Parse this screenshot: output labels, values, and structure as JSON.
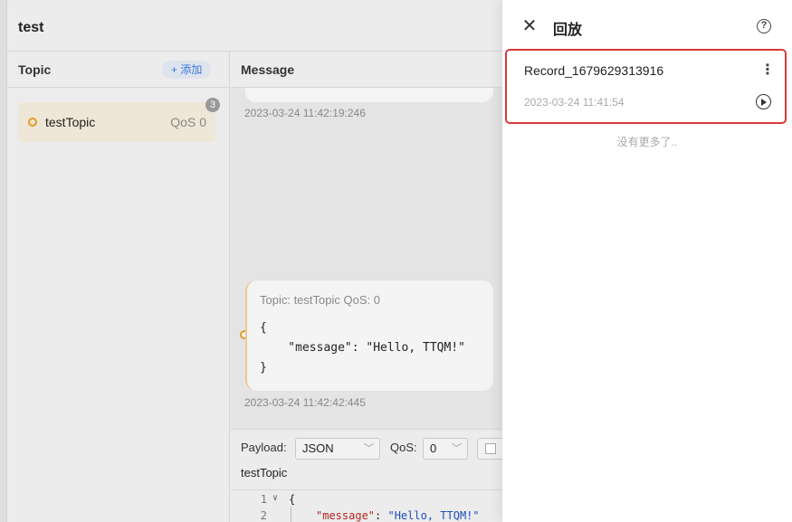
{
  "app": {
    "connection_title": "test"
  },
  "topics": {
    "header": "Topic",
    "add_label": "+ 添加",
    "badge_count": "3",
    "items": [
      {
        "name": "testTopic",
        "qos": "QoS 0"
      }
    ]
  },
  "messages": {
    "header": "Message",
    "items": [
      {
        "time": "2023-03-24 11:42:19:246"
      },
      {
        "meta": "Topic: testTopic  QoS: 0",
        "payload": "{\n    \"message\": \"Hello, TTQM!\"\n}",
        "time": "2023-03-24 11:42:42:445"
      }
    ]
  },
  "composer": {
    "payload_label": "Payload:",
    "payload_format": "JSON",
    "qos_label": "QoS:",
    "qos_value": "0",
    "topic": "testTopic",
    "editor": {
      "line1_no": "1",
      "line2_no": "2",
      "line1": "{",
      "line2_key": "\"message\"",
      "line2_sep": ": ",
      "line2_val": "\"Hello, TTQM!\""
    }
  },
  "drawer": {
    "title": "回放",
    "records": [
      {
        "name": "Record_1679629313916",
        "time": "2023-03-24 11:41:54"
      }
    ],
    "empty_text": "没有更多了.."
  },
  "colors": {
    "accent": "#e39a24",
    "highlight_border": "#d83a3a",
    "link": "#3a78d8"
  }
}
